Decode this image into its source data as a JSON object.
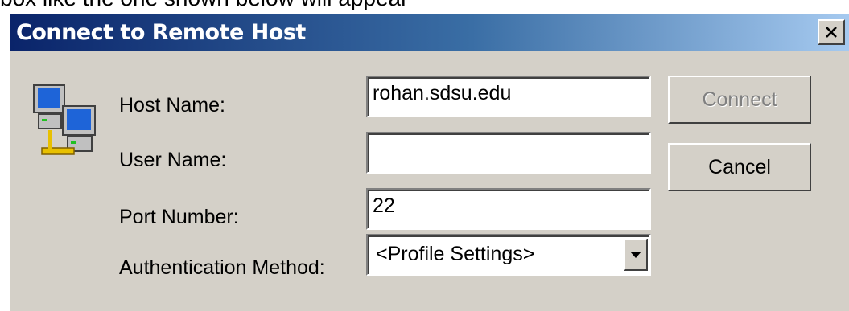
{
  "background_text": "box like the one shown below will appear",
  "dialog": {
    "title": "Connect to Remote Host",
    "close_glyph": "X"
  },
  "form": {
    "host_label": "Host Name:",
    "host_value": "rohan.sdsu.edu",
    "user_label": "User Name:",
    "user_value": "",
    "port_label": "Port Number:",
    "port_value": "22",
    "auth_label": "Authentication Method:",
    "auth_value": "<Profile Settings>"
  },
  "buttons": {
    "connect_label": "Connect",
    "connect_enabled": false,
    "cancel_label": "Cancel"
  },
  "icons": {
    "dialog_icon": "networked-computers-icon",
    "close": "close-icon",
    "dropdown": "dropdown-arrow-icon"
  },
  "colors": {
    "titlebar_start": "#0a246a",
    "titlebar_end": "#a6caf0",
    "dialog_bg": "#d4d0c8"
  }
}
